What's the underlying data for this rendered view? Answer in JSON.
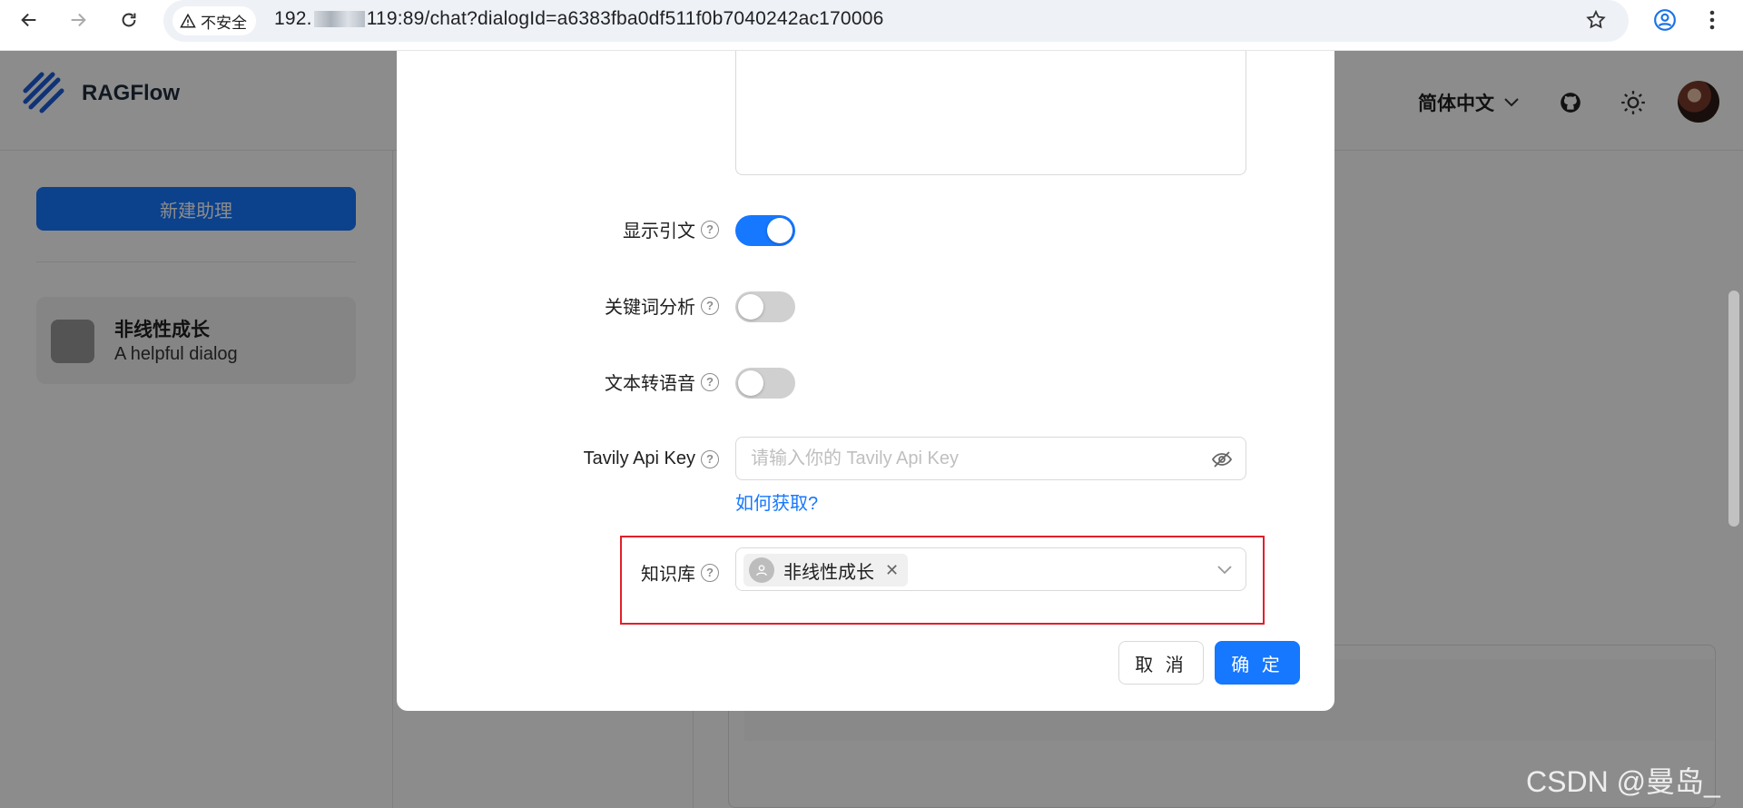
{
  "browser": {
    "insecure_label": "不安全",
    "url_prefix": "192.",
    "url_suffix": "119:89/chat?dialogId=a6383fba0df511f0b7040242ac170006"
  },
  "app": {
    "brand": "RAGFlow",
    "language": "简体中文",
    "new_assistant": "新建助理",
    "dialog": {
      "name": "非线性成长",
      "description": "A helpful dialog"
    }
  },
  "modal": {
    "show_quote": {
      "label": "显示引文",
      "on": true
    },
    "keyword_analysis": {
      "label": "关键词分析",
      "on": false
    },
    "tts": {
      "label": "文本转语音",
      "on": false
    },
    "tavily": {
      "label": "Tavily Api Key",
      "placeholder": "请输入你的 Tavily Api Key",
      "value": "",
      "help_link": "如何获取?"
    },
    "knowledge_base": {
      "label": "知识库",
      "selected": [
        "非线性成长"
      ]
    },
    "cancel": "取 消",
    "ok": "确 定"
  },
  "watermark": "CSDN @曼岛_",
  "colors": {
    "primary": "#1677ff",
    "highlight_border": "#e0202a"
  }
}
